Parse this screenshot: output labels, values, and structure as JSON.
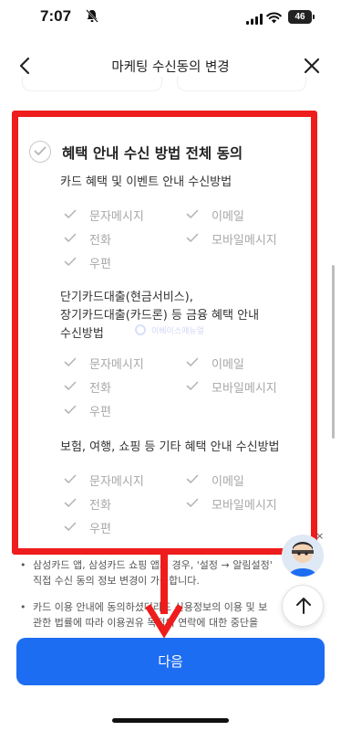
{
  "status_bar": {
    "time": "7:07",
    "battery": "46"
  },
  "header": {
    "title": "마케팅 수신동의 변경"
  },
  "consent": {
    "all_label": "혜택 안내 수신 방법 전체 동의",
    "sections": [
      {
        "title": "카드 혜택 및 이벤트 안내 수신방법",
        "options": [
          "문자메시지",
          "이메일",
          "전화",
          "모바일메시지",
          "우편"
        ]
      },
      {
        "title_lines": [
          "단기카드대출(현금서비스),",
          "장기카드대출(카드론) 등 금융 혜택 안내",
          "수신방법"
        ],
        "options": [
          "문자메시지",
          "이메일",
          "전화",
          "모바일메시지",
          "우편"
        ]
      },
      {
        "title": "보험, 여행, 쇼핑 등 기타 혜택 안내 수신방법",
        "options": [
          "문자메시지",
          "이메일",
          "전화",
          "모바일메시지",
          "우편"
        ]
      }
    ]
  },
  "watermark": "이베이스매뉴얼",
  "notices": [
    {
      "bullet": "•",
      "lines": [
        "삼성카드 앱, 삼성카드 쇼핑 앱의 경우, '설정 → 알림설정'",
        "직접 수신 동의 정보 변경이 가능합니다."
      ]
    },
    {
      "bullet": "•",
      "lines": [
        "카드 이용 안내에 동의하셨더라도 신용정보의 이용 및 보",
        "관한 법률에 따라 이용권유 목적의 연락에 대한 중단을"
      ]
    }
  ],
  "chat_close": "×",
  "next_button": "다음",
  "colors": {
    "primary": "#1d6df2",
    "highlight": "#ee1c1c",
    "check": "#b5b5b5"
  }
}
